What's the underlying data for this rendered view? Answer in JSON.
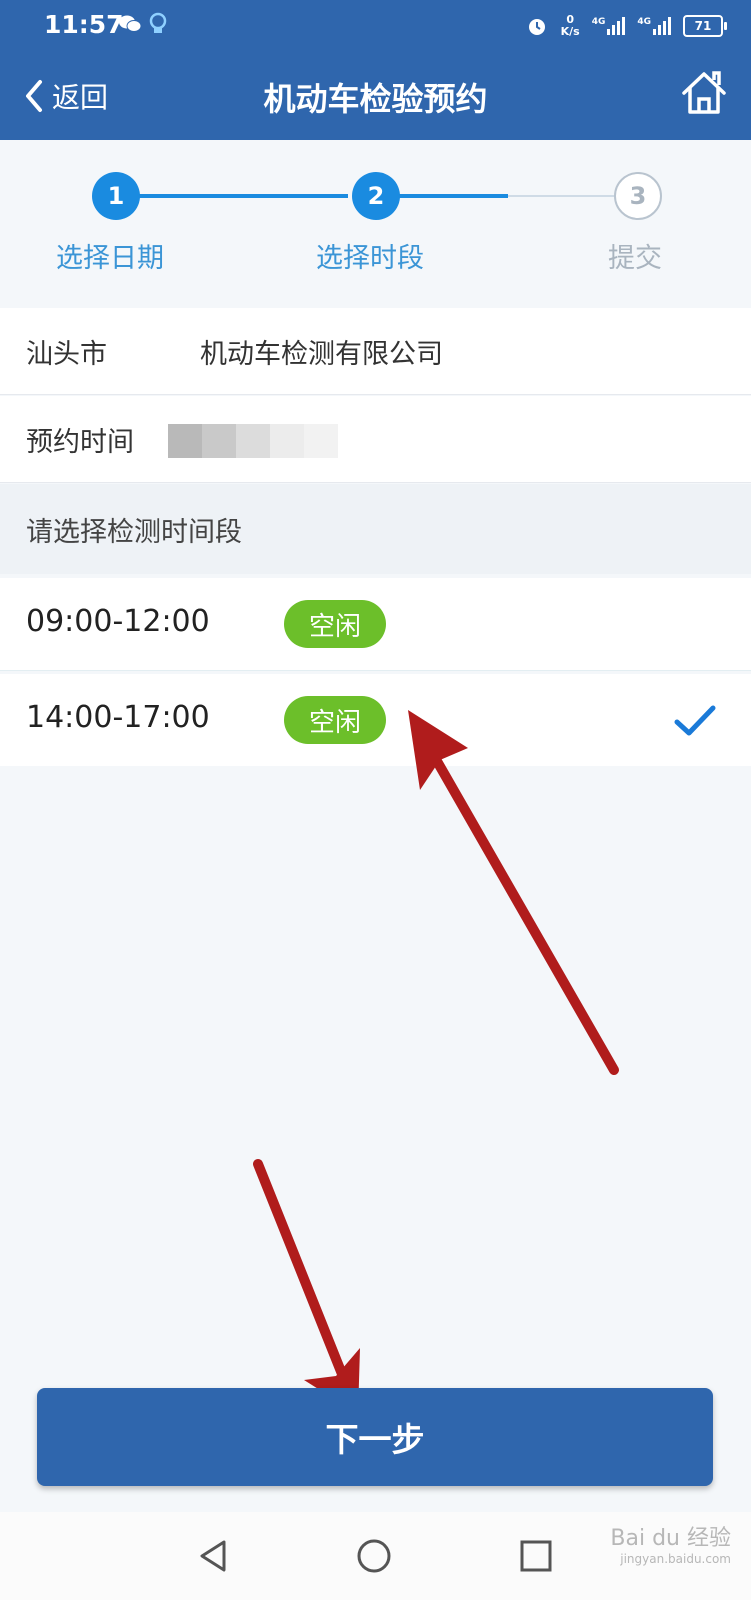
{
  "status_bar": {
    "time": "11:57",
    "speed_value": "0",
    "speed_unit": "K/s",
    "battery": "71",
    "signal1_label": "4G",
    "signal2_label": "4G"
  },
  "nav": {
    "back_label": "返回",
    "title": "机动车检验预约"
  },
  "steps": [
    {
      "number": "1",
      "label": "选择日期",
      "state": "done"
    },
    {
      "number": "2",
      "label": "选择时段",
      "state": "active"
    },
    {
      "number": "3",
      "label": "提交",
      "state": "pending"
    }
  ],
  "station": {
    "city": "汕头市",
    "name": "机动车检测有限公司"
  },
  "appointment": {
    "label": "预约时间"
  },
  "section_hint": "请选择检测时间段",
  "slots": [
    {
      "time": "09:00-12:00",
      "status": "空闲",
      "selected": false
    },
    {
      "time": "14:00-17:00",
      "status": "空闲",
      "selected": true
    }
  ],
  "next_button": "下一步",
  "watermark": {
    "brand": "Bai du 经验",
    "url": "jingyan.baidu.com"
  },
  "colors": {
    "primary": "#2f66ad",
    "step_active": "#1a8be0",
    "badge": "#6cbf2a",
    "annotation_arrow": "#b01c1c"
  }
}
